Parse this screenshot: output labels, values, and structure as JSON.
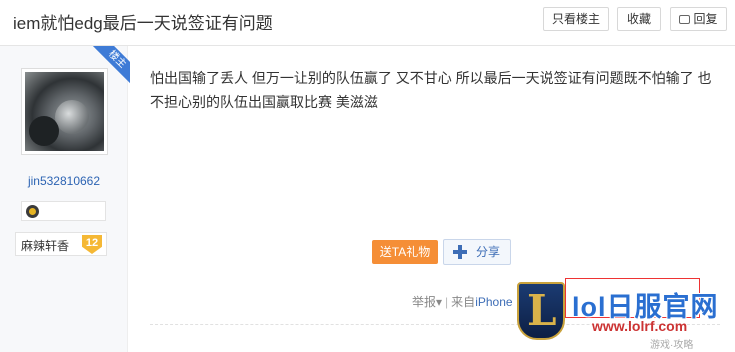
{
  "header": {
    "title": "iem就怕edg最后一天说签证有问题",
    "only_op_label": "只看楼主",
    "favorite_label": "收藏",
    "reply_label": "回复"
  },
  "author": {
    "op_badge": "楼主",
    "username": "jin532810662",
    "level_name": "麻辣轩香",
    "level": "12",
    "avatar": "avatar-image"
  },
  "post": {
    "content": "怕出国输了丢人 但万一让别的队伍赢了 又不甘心 所以最后一天说签证有问题既不怕输了 也不担心别的队伍出国赢取比赛 美滋滋",
    "gift_label": "送TA礼物",
    "share_label": "分享",
    "report_label": "举报",
    "from_prefix": "来自",
    "device": "iPhone"
  },
  "watermark": {
    "brand": "lol日服官网",
    "url": "www.lolrf.com",
    "small": "游戏·攻略"
  },
  "colors": {
    "accent": "#3d6db6",
    "gift": "#f58e36",
    "op_ribbon": "#3e7bd6",
    "level_badge": "#f5b835"
  }
}
